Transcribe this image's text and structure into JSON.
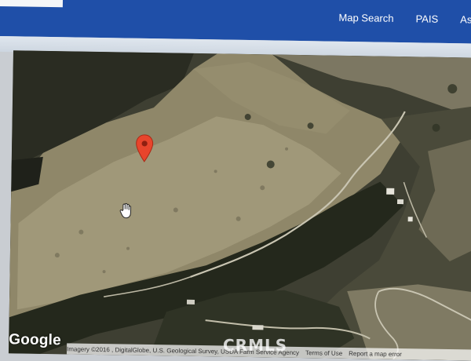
{
  "nav": {
    "items": [
      "Map Search",
      "PAIS",
      "Assessor"
    ]
  },
  "map": {
    "view": "satellite",
    "provider_logo": "Google",
    "attribution": "Imagery ©2016 , DigitalGlobe, U.S. Geological Survey, USDA Farm Service Agency",
    "terms_label": "Terms of Use",
    "report_label": "Report a map error",
    "marker_icon": "location-pin-icon",
    "cursor_icon": "hand-cursor-icon"
  },
  "watermark": "CRMLS",
  "colors": {
    "nav_bar": "#1f4fa8",
    "marker": "#e8452c",
    "terrain_light": "#a39b7c",
    "terrain_dark": "#24281c"
  }
}
